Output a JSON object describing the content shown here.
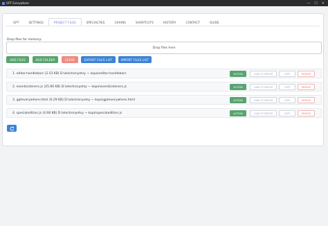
{
  "window": {
    "title": "GPT Everywhere",
    "controls": [
      "—",
      "☐",
      "✕"
    ]
  },
  "tabs": [
    {
      "label": "GPT"
    },
    {
      "label": "SETTINGS"
    },
    {
      "label": "PROJECT FILES"
    },
    {
      "label": "SPECIALTIES"
    },
    {
      "label": "CHAINS"
    },
    {
      "label": "SHORTCUTS"
    },
    {
      "label": "HISTORY"
    },
    {
      "label": "CONTACT"
    },
    {
      "label": "GUIDE"
    }
  ],
  "active_tab": "PROJECT FILES",
  "dropzone": {
    "label": "Drop files for memory:",
    "hint": "Drop files here"
  },
  "actions": {
    "add_files": "ADD FILES",
    "add_folder": "ADD FOLDER",
    "clear": "CLEAR",
    "export": "EXPORT FILES LIST",
    "import": "IMPORT FILES LIST"
  },
  "files": [
    {
      "text": "1. editor.handlebars (2.53 KB) D:\\electronyetsy ~ kopo\\editor.handlebars",
      "action": "ACTION",
      "load": "LOAD TO EDITOR",
      "copy": "COPY",
      "remove": "REMOVE"
    },
    {
      "text": "2. eventListeners.js (25.66 KB) D:\\electronyetsy ~ kopo\\eventListeners.js",
      "action": "ACTION",
      "load": "LOAD TO EDITOR",
      "copy": "COPY",
      "remove": "REMOVE"
    },
    {
      "text": "3. gpteverywhere.html (6.29 KB) D:\\electronyetsy ~ kopo\\gpteverywhere.html",
      "action": "ACTION",
      "load": "LOAD TO EDITOR",
      "copy": "COPY",
      "remove": "REMOVE"
    },
    {
      "text": "4. specialedition.js (4.68 KB) D:\\electronyetsy ~ kopo\\specialedition.js",
      "action": "ACTION",
      "load": "LOAD TO EDITOR",
      "copy": "COPY",
      "remove": "REMOVE"
    }
  ],
  "icons": {
    "refresh": "refresh-icon",
    "app": "app-icon"
  },
  "colors": {
    "green": "#5aa371",
    "red": "#ef8b80",
    "blue": "#3c82d6",
    "active_tab": "#6c7ae0"
  }
}
